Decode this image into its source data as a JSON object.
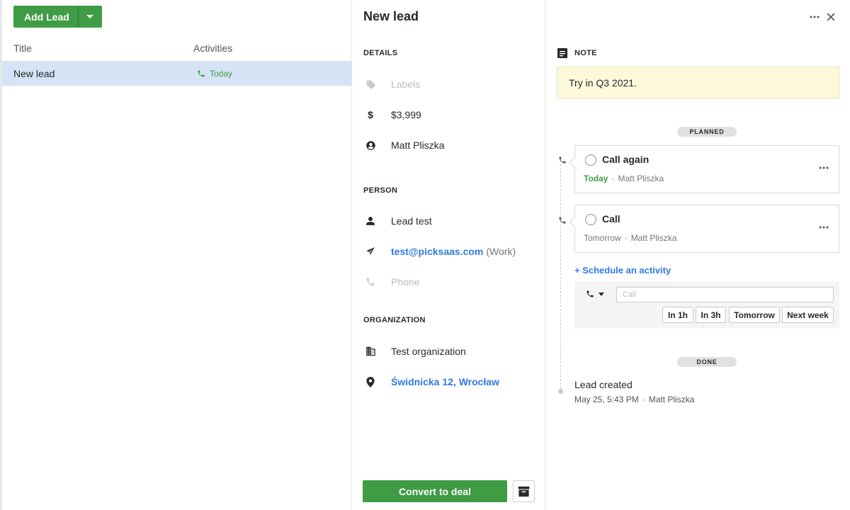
{
  "left": {
    "add_lead_label": "Add Lead",
    "columns": {
      "title": "Title",
      "activities": "Activities"
    },
    "rows": [
      {
        "title": "New lead",
        "activity": "Today"
      }
    ]
  },
  "detail": {
    "title": "New lead",
    "details_heading": "DETAILS",
    "labels_placeholder": "Labels",
    "value": "$3,999",
    "owner": "Matt Pliszka",
    "person_heading": "PERSON",
    "person_name": "Lead test",
    "email": "test@picksaas.com",
    "email_type": "(Work)",
    "phone_placeholder": "Phone",
    "organization_heading": "ORGANIZATION",
    "organization_name": "Test organization",
    "address": "Świdnicka 12, Wrocław",
    "convert_label": "Convert to deal"
  },
  "timeline": {
    "note_heading": "NOTE",
    "note_text": "Try in Q3 2021.",
    "planned_label": "PLANNED",
    "activities": [
      {
        "name": "Call again",
        "when": "Today",
        "sep": "·",
        "user": "Matt Pliszka"
      },
      {
        "name": "Call",
        "when": "Tomorrow",
        "sep": "·",
        "user": "Matt Pliszka"
      }
    ],
    "schedule_label": "+ Schedule an activity",
    "schedule_placeholder": "Call",
    "quick_buttons": [
      "In 1h",
      "In 3h",
      "Tomorrow",
      "Next week"
    ],
    "done_label": "DONE",
    "created_title": "Lead created",
    "created_time": "May 25, 5:43 PM",
    "created_sep": "·",
    "created_user": "Matt Pliszka"
  },
  "colors": {
    "green": "#3f9c45",
    "blue": "#317ae2",
    "selected_row": "#d5e3f5",
    "note_bg": "#fff9db"
  }
}
